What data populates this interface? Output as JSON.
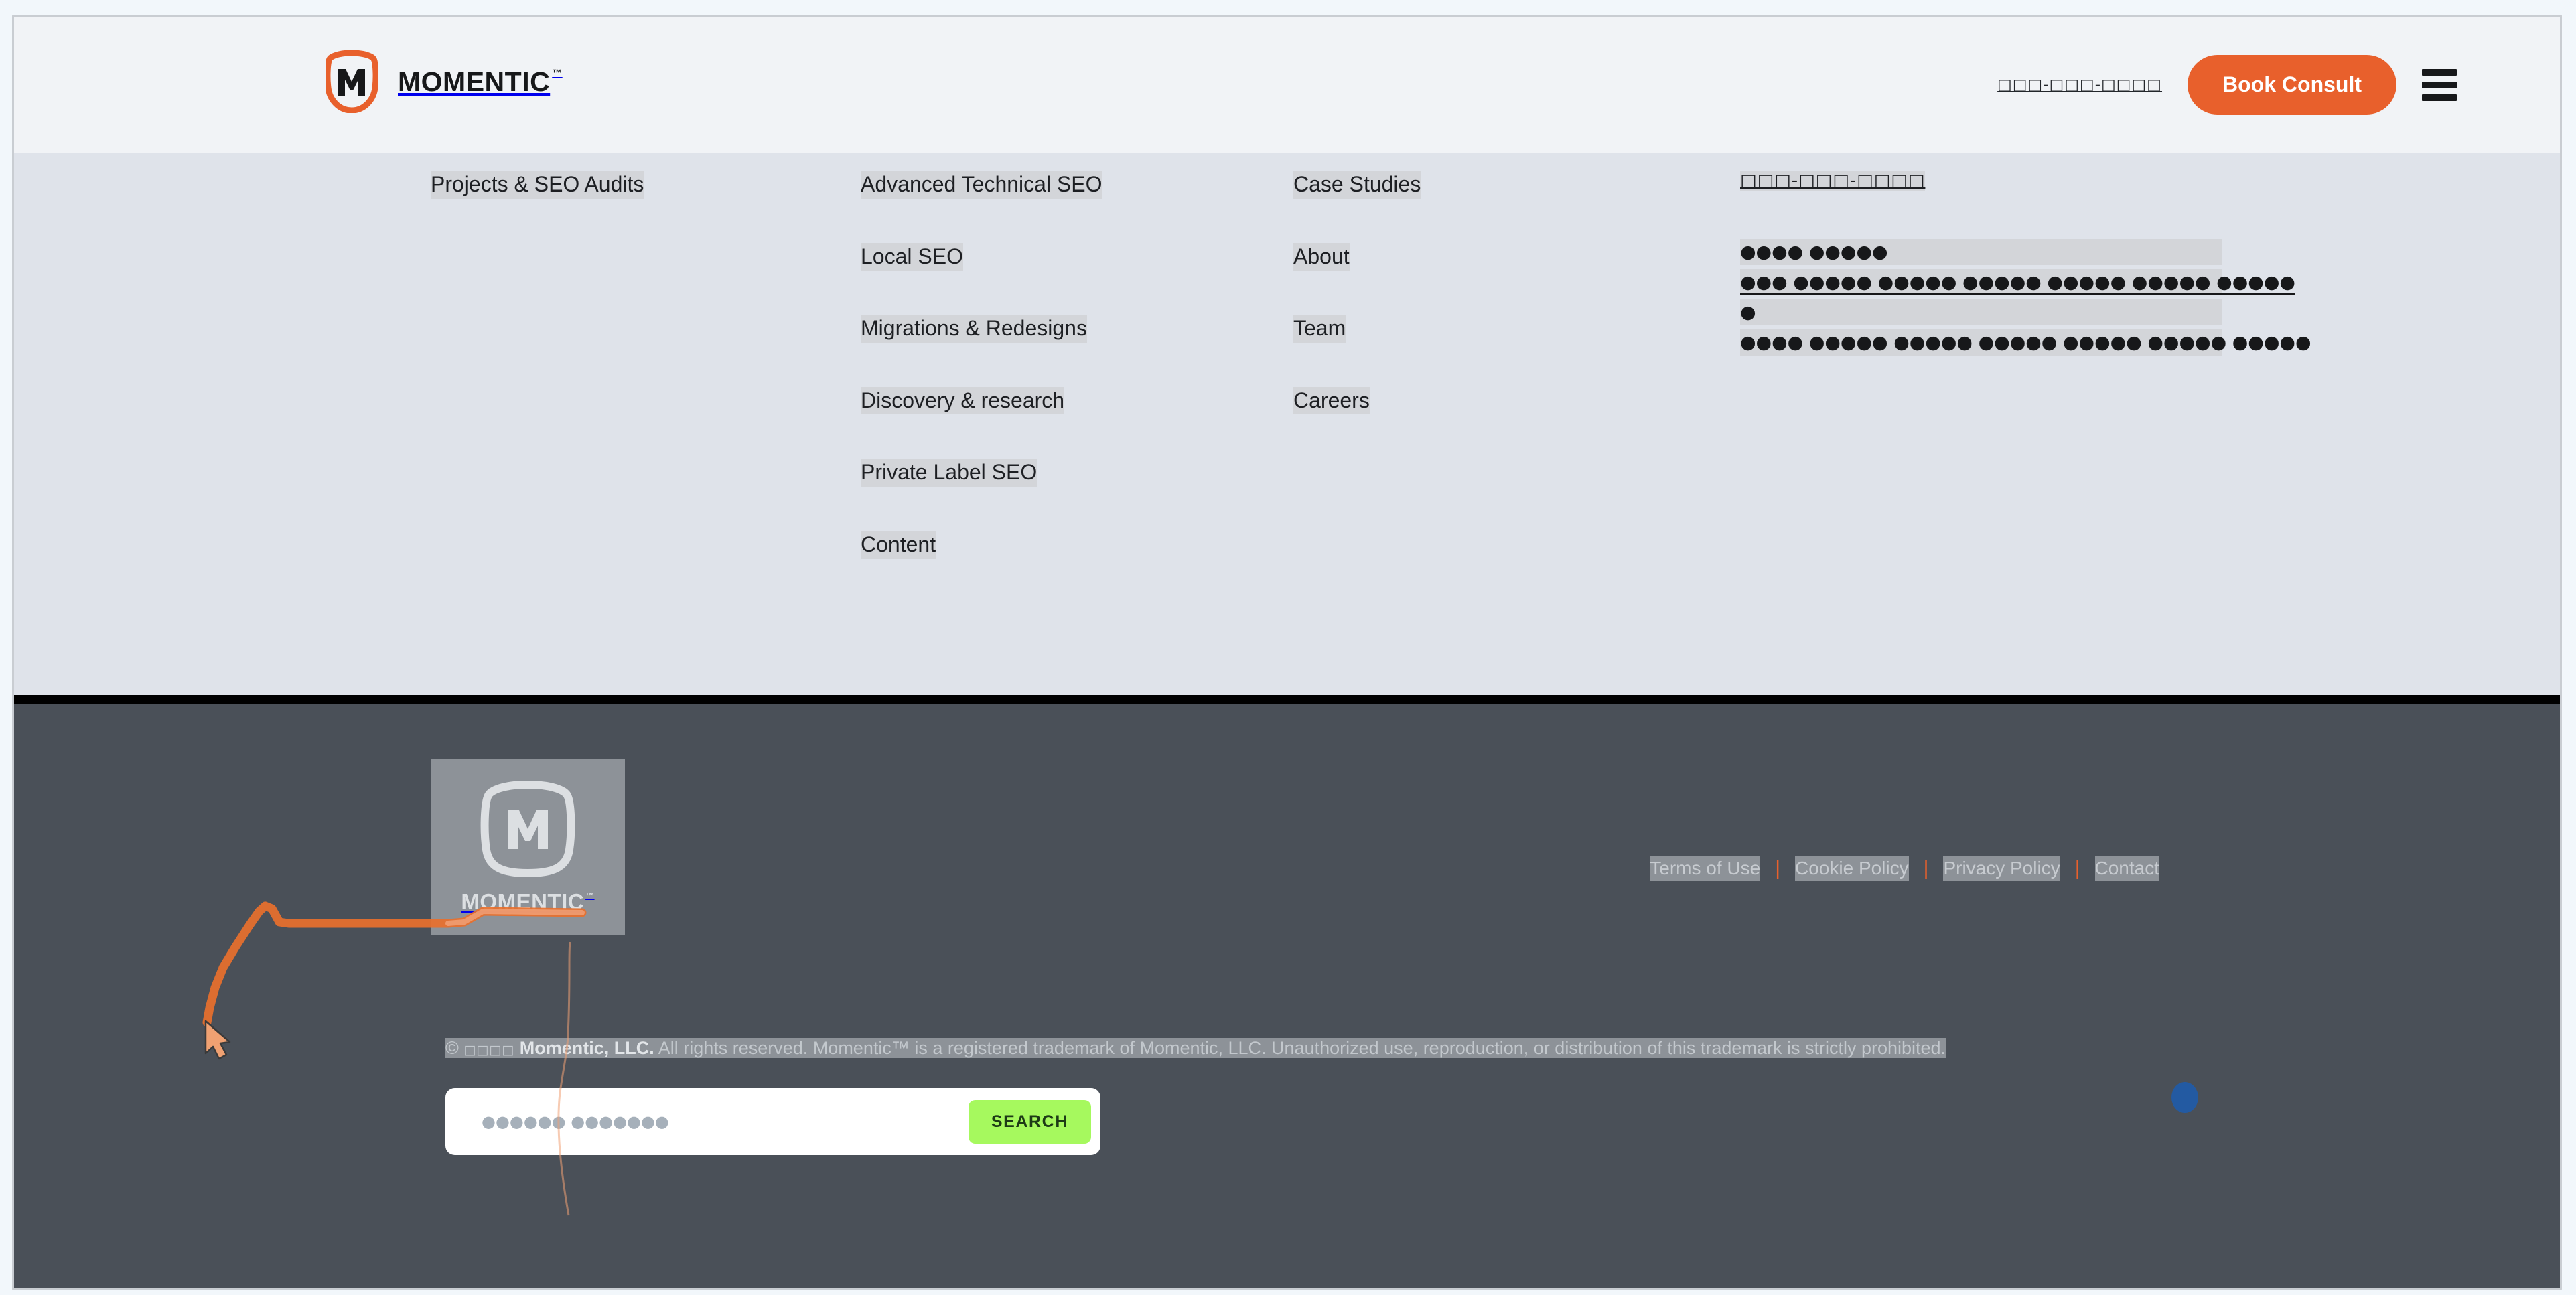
{
  "header": {
    "brand_name": "MOMENTIC",
    "brand_tm": "™",
    "phone_masked": "□□□-□□□-□□□□",
    "book_consult_label": "Book Consult",
    "menu_icon": "hamburger-icon",
    "logo_icon": "momentic-shield-m-logo"
  },
  "nav_panel": {
    "columns": [
      {
        "id": "services-primary",
        "items": [
          {
            "label": "Projects & SEO Audits"
          }
        ]
      },
      {
        "id": "services-secondary",
        "items": [
          {
            "label": "Advanced Technical SEO"
          },
          {
            "label": "Local SEO"
          },
          {
            "label": "Migrations & Redesigns"
          },
          {
            "label": "Discovery & research"
          },
          {
            "label": "Private Label SEO"
          },
          {
            "label": "Content"
          }
        ]
      },
      {
        "id": "company",
        "items": [
          {
            "label": "Case Studies"
          },
          {
            "label": "About"
          },
          {
            "label": "Team"
          },
          {
            "label": "Careers"
          }
        ]
      }
    ],
    "contact": {
      "phone_masked": "□□□-□□□-□□□□",
      "hours_masked": "●●●● ●●●●●",
      "address_line_1_masked": "●●● ●●●●● ●●●●● ●●●●● ●●●●● ●●●●● ●●●●●",
      "address_line_2_masked": "●",
      "address_line_3_masked": "●●●● ●●●●● ●●●●● ●●●●● ●●●●● ●●●●● ●●●●●"
    }
  },
  "footer": {
    "logo_name": "MOMENTIC",
    "logo_tm": "™",
    "logo_icon": "momentic-shield-m-logo",
    "links": [
      {
        "label": "Terms of Use"
      },
      {
        "label": "Cookie Policy"
      },
      {
        "label": "Privacy Policy"
      },
      {
        "label": "Contact"
      }
    ],
    "separator": "|",
    "copyright": {
      "prefix": "© ",
      "year_masked": "□□□□",
      "company": " Momentic, LLC.",
      "rest": " All rights reserved. Momentic™ is a registered trademark of Momentic, LLC. Unauthorized use, reproduction, or distribution of this trademark is strictly prohibited."
    },
    "search": {
      "placeholder_masked": "●●●●●● ●●●●●●●",
      "value": "",
      "submit_label": "SEARCH"
    }
  },
  "annotations": {
    "cursor_icon": "arrow-pointer-cursor",
    "cursor_color": "#f0a172",
    "trail_color": "#e8702c",
    "dot_indicator_color": "#1f5ba8"
  },
  "colors": {
    "brand_orange": "#e8602c",
    "nav_panel_bg": "#dfe3ea",
    "footer_bg": "#4a5058",
    "search_button_green": "#a6f95e",
    "highlight_gray": "#d3d5d9"
  }
}
